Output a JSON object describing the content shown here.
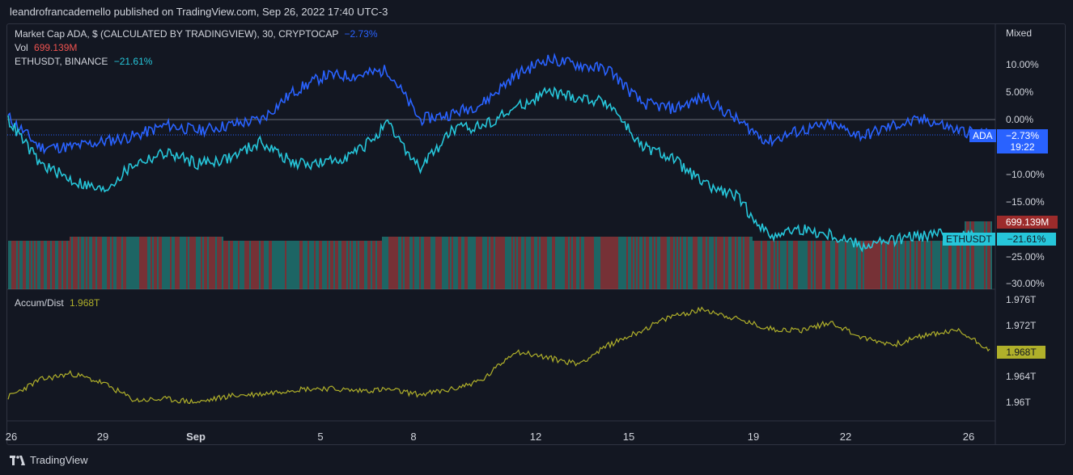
{
  "publisher_line": "leandrofrancademello published on TradingView.com, Sep 26, 2022 17:40 UTC-3",
  "legend": {
    "main": {
      "label": "Market Cap ADA, $ (CALCULATED BY TRADINGVIEW), 30, CRYPTOCAP",
      "value": "−2.73%"
    },
    "vol": {
      "label": "Vol",
      "value": "699.139M"
    },
    "eth": {
      "label": "ETHUSDT, BINANCE",
      "value": "−21.61%"
    },
    "accum": {
      "label": "Accum/Dist",
      "value": "1.968T"
    }
  },
  "scale_mode": "Mixed",
  "price_axis": [
    "10.00%",
    "5.00%",
    "0.00%",
    "−10.00%",
    "−15.00%",
    "−25.00%",
    "−30.00%"
  ],
  "accum_axis": [
    "1.976T",
    "1.972T",
    "1.964T",
    "1.96T"
  ],
  "tags": {
    "ada_name": "ADA",
    "ada_value": "−2.73%",
    "ada_countdown": "19:22",
    "vol_value": "699.139M",
    "eth_name": "ETHUSDT",
    "eth_value": "−21.61%",
    "accum_value": "1.968T"
  },
  "x_axis": [
    "26",
    "29",
    "Sep",
    "5",
    "8",
    "12",
    "15",
    "19",
    "22",
    "26"
  ],
  "footer_brand": "TradingView",
  "colors": {
    "ada": "#2962ff",
    "eth": "#26c6da",
    "vol_up": "#26a69a",
    "vol_down": "#ef5350",
    "accum": "#b0b02a",
    "vol_tag": "#9c2b2b",
    "background": "#131722"
  },
  "chart_data": [
    {
      "type": "line",
      "series": [
        {
          "name": "Market Cap ADA, $ (CALCULATED BY TRADINGVIEW), 30, CRYPTOCAP",
          "x": [
            "26",
            "27",
            "28",
            "29",
            "30",
            "31",
            "Sep",
            "2",
            "3",
            "4",
            "5",
            "6",
            "7",
            "8",
            "9",
            "10",
            "11",
            "12",
            "13",
            "14",
            "15",
            "16",
            "17",
            "18",
            "19",
            "20",
            "21",
            "22",
            "23",
            "24",
            "25",
            "26"
          ],
          "values": [
            0.5,
            -5,
            -5,
            -4,
            -3,
            -1,
            -2,
            -1,
            0,
            5,
            8,
            8,
            9,
            0,
            1,
            3,
            8,
            11,
            10,
            9,
            3,
            2,
            4,
            0,
            -4,
            -2,
            -1,
            -3,
            -1,
            0,
            -2,
            -2.73
          ]
        },
        {
          "name": "ETHUSDT, BINANCE",
          "x": [
            "26",
            "27",
            "28",
            "29",
            "30",
            "31",
            "Sep",
            "2",
            "3",
            "4",
            "5",
            "6",
            "7",
            "8",
            "9",
            "10",
            "11",
            "12",
            "13",
            "14",
            "15",
            "16",
            "17",
            "18",
            "19",
            "20",
            "21",
            "22",
            "23",
            "24",
            "25",
            "26"
          ],
          "values": [
            0,
            -8,
            -11,
            -13,
            -8,
            -6,
            -8,
            -7,
            -4,
            -8,
            -8,
            -6,
            -1,
            -9,
            -2,
            -1,
            2,
            5,
            4,
            3,
            -5,
            -7,
            -12,
            -14,
            -21,
            -20,
            -21,
            -23,
            -22,
            -21,
            -21,
            -21.61
          ]
        }
      ],
      "ylim": [
        -30,
        13
      ],
      "y_unit": "%"
    },
    {
      "type": "bar",
      "series": [
        {
          "name": "Vol",
          "last_value": "699.139M"
        }
      ]
    },
    {
      "type": "line",
      "series": [
        {
          "name": "Accum/Dist",
          "x": [
            "26",
            "27",
            "28",
            "29",
            "30",
            "31",
            "Sep",
            "2",
            "3",
            "4",
            "5",
            "6",
            "7",
            "8",
            "9",
            "10",
            "11",
            "12",
            "13",
            "14",
            "15",
            "16",
            "17",
            "18",
            "19",
            "20",
            "21",
            "22",
            "23",
            "24",
            "25",
            "26"
          ],
          "values": [
            1.9608,
            1.9635,
            1.9645,
            1.963,
            1.9603,
            1.9605,
            1.96,
            1.961,
            1.9613,
            1.962,
            1.9622,
            1.9618,
            1.962,
            1.9612,
            1.962,
            1.9635,
            1.968,
            1.967,
            1.966,
            1.969,
            1.9712,
            1.9735,
            1.9745,
            1.973,
            1.9715,
            1.9712,
            1.9725,
            1.97,
            1.969,
            1.9705,
            1.9712,
            1.9683
          ]
        }
      ],
      "ylim": [
        1.958,
        1.977
      ]
    }
  ]
}
